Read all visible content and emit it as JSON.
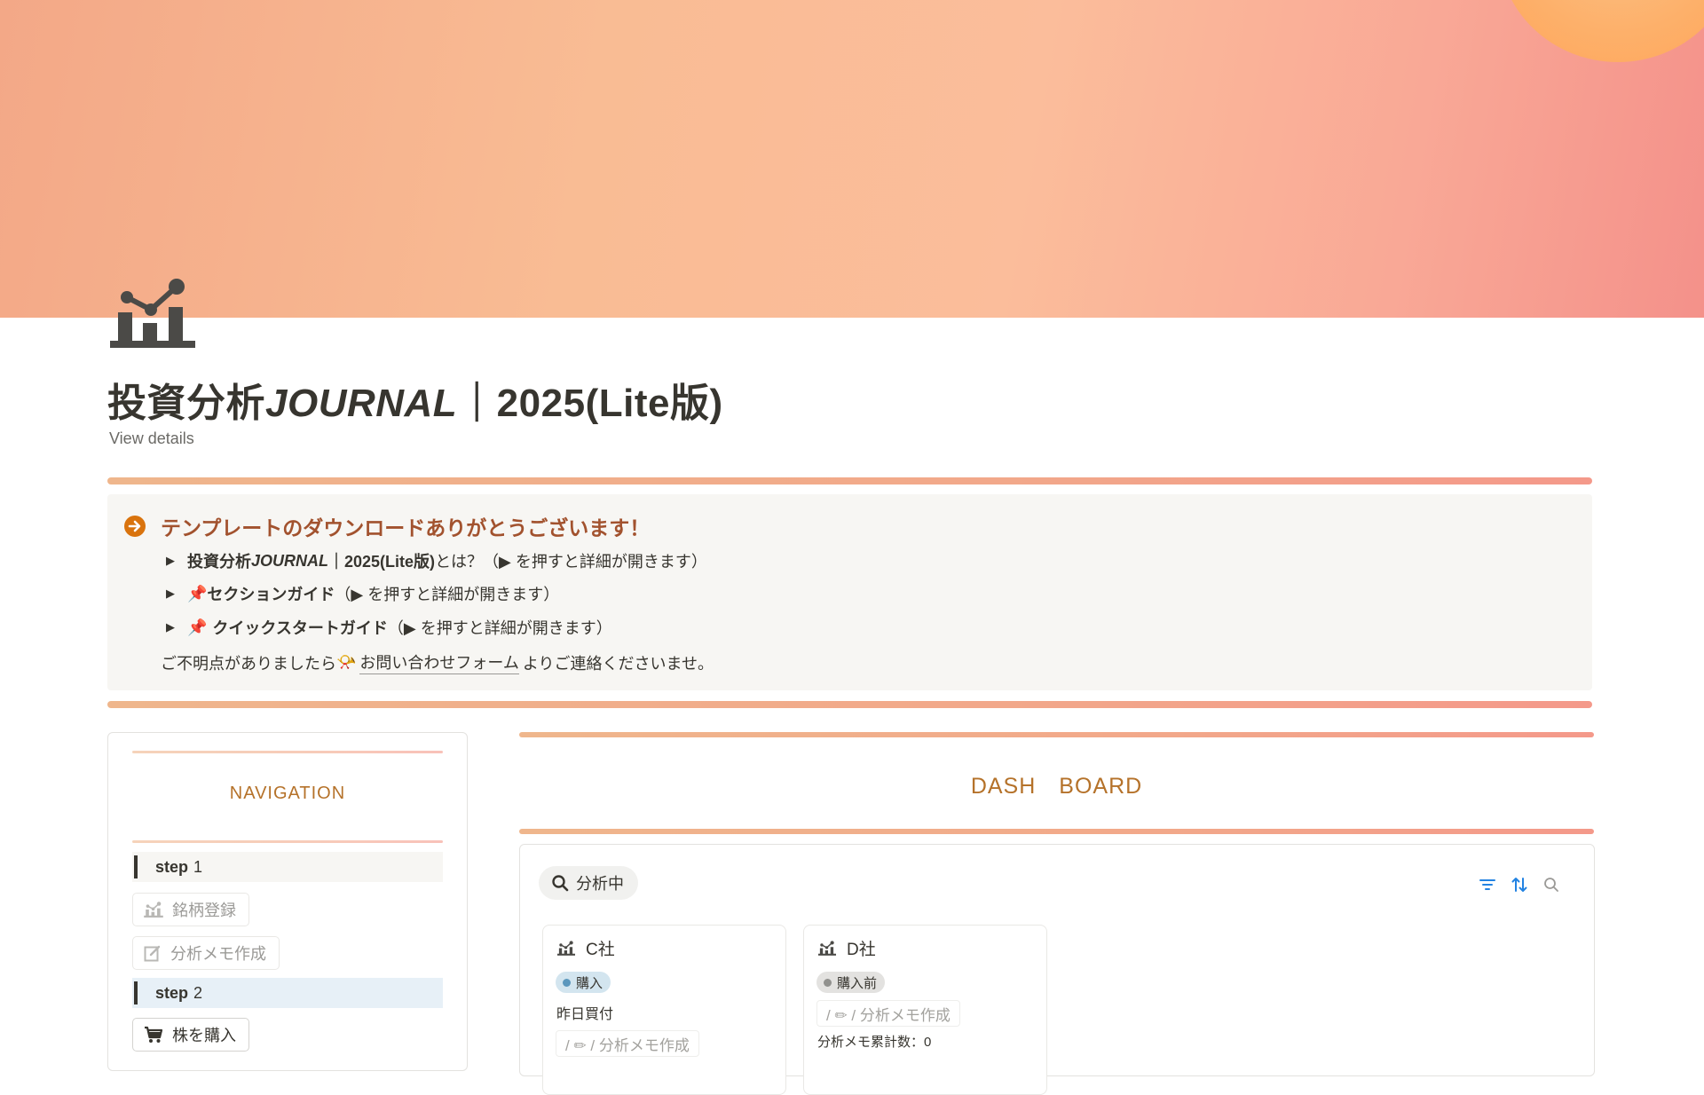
{
  "page": {
    "title_prefix": "投資分析",
    "title_brand": "JOURNAL",
    "title_suffix": "｜2025(Lite版)",
    "view_details": "View details",
    "icon": "chart-person-icon"
  },
  "callout": {
    "icon": "arrow-circle-icon",
    "title": "テンプレートのダウンロードありがとうございます！",
    "toggles": [
      {
        "bold_prefix": "投資分析",
        "bold_brand": "JOURNAL",
        "bold_suffix": "｜2025(Lite版)",
        "text": "とは？（▶ を押すと詳細が開きます）"
      },
      {
        "emoji": "📌",
        "bold": "セクションガイド",
        "text": "（▶ を押すと詳細が開きます）"
      },
      {
        "emoji": "📌",
        "bold": "クイックスタートガイド",
        "text": "（▶ を押すと詳細が開きます）"
      }
    ],
    "footer_before": "ご不明点がありましたら",
    "footer_emoji": "📯",
    "footer_link": "お問い合わせフォーム",
    "footer_after": "よりご連絡くださいませ。"
  },
  "navigation": {
    "title": "NAVIGATION",
    "step1_label": "step",
    "step1_num": "1",
    "btn_register": "銘柄登録",
    "btn_memo": "分析メモ作成",
    "step2_label": "step",
    "step2_num": "2",
    "btn_buy": "株を購入"
  },
  "dashboard": {
    "title": "DASH　BOARD",
    "view_tab": "分析中",
    "cards": [
      {
        "name": "C社",
        "tag": "購入",
        "tag_color": "#d3e5ef",
        "dot_color": "#5b97bd",
        "line1": "昨日買付",
        "chip": "/ ✏ / 分析メモ作成"
      },
      {
        "name": "D社",
        "tag": "購入前",
        "tag_color": "#e3e2e0",
        "dot_color": "#91918e",
        "chip": "/ ✏ / 分析メモ作成",
        "line2": "分析メモ累計数：0"
      }
    ]
  },
  "colors": {
    "accent_orange": "#b5722a",
    "callout_title": "#a2522e",
    "step2_highlight": "#e7f0f7",
    "tool_blue": "#2383e2"
  }
}
